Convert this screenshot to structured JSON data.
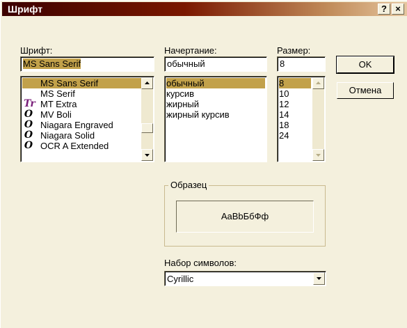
{
  "window": {
    "title": "Шрифт",
    "help_btn": "?",
    "close_btn": "×"
  },
  "font": {
    "label": "Шрифт:",
    "value": "MS Sans Serif",
    "items": [
      {
        "name": "MS Sans Serif",
        "icon": "",
        "selected": true
      },
      {
        "name": "MS Serif",
        "icon": ""
      },
      {
        "name": "MT Extra",
        "icon": "Tr"
      },
      {
        "name": "MV Boli",
        "icon": "O"
      },
      {
        "name": "Niagara Engraved",
        "icon": "O"
      },
      {
        "name": "Niagara Solid",
        "icon": "O"
      },
      {
        "name": "OCR A Extended",
        "icon": "O"
      }
    ]
  },
  "style": {
    "label": "Начертание:",
    "value": "обычный",
    "items": [
      "обычный",
      "курсив",
      "жирный",
      "жирный курсив"
    ]
  },
  "size": {
    "label": "Размер:",
    "value": "8",
    "items": [
      "8",
      "10",
      "12",
      "14",
      "18",
      "24"
    ]
  },
  "buttons": {
    "ok": "OK",
    "cancel": "Отмена"
  },
  "sample": {
    "label": "Образец",
    "text": "AaBbБбФф"
  },
  "charset": {
    "label": "Набор символов:",
    "value": "Cyrillic"
  },
  "colors": {
    "titlebar_start": "#3c0100",
    "titlebar_end": "#e6c7a0",
    "selection": "#c2a14a",
    "face": "#f4f0dd"
  }
}
